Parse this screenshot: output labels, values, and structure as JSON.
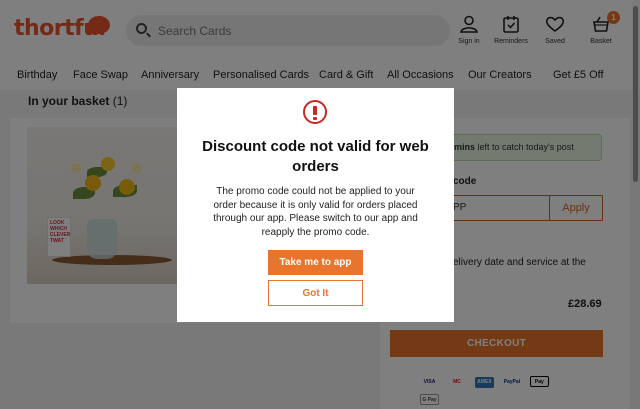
{
  "header": {
    "logo_text": "thortful",
    "search_placeholder": "Search Cards",
    "icons": [
      {
        "name": "user-icon",
        "label": "Sign in"
      },
      {
        "name": "calendar-icon",
        "label": "Reminders"
      },
      {
        "name": "heart-icon",
        "label": "Saved"
      },
      {
        "name": "basket-icon",
        "label": "Basket",
        "badge": "1"
      }
    ]
  },
  "nav": {
    "items": [
      "Birthday",
      "Face Swap",
      "Anniversary",
      "Personalised Cards",
      "Card & Gift",
      "All Occasions",
      "Our Creators",
      "Get £5 Off"
    ]
  },
  "basket": {
    "title": "In your basket",
    "count": "(1)",
    "card_text": "LOOK WHICH CLEVER TWAT"
  },
  "summary": {
    "post_banner_bold": "mins",
    "post_banner_text": " left to catch today's post",
    "discount_label": "code",
    "discount_value": "PP",
    "apply_label": "Apply",
    "delivery_text": "elivery date and service at the",
    "total": "£28.69",
    "hint_fragment": "ed",
    "checkout_label": "CHECKOUT",
    "payments": [
      "VISA",
      "MC",
      "AMEX",
      "PayPal",
      "Pay",
      "G Pay"
    ]
  },
  "modal": {
    "title": "Discount code not valid for web orders",
    "body": "The promo code could not be applied to your order because it is only valid for orders placed through our app. Please switch to our app and reapply the promo code.",
    "primary_label": "Take me to app",
    "secondary_label": "Got It"
  },
  "colors": {
    "brand": "#e8542d",
    "accent": "#e8742d",
    "alert": "#c8281e"
  }
}
